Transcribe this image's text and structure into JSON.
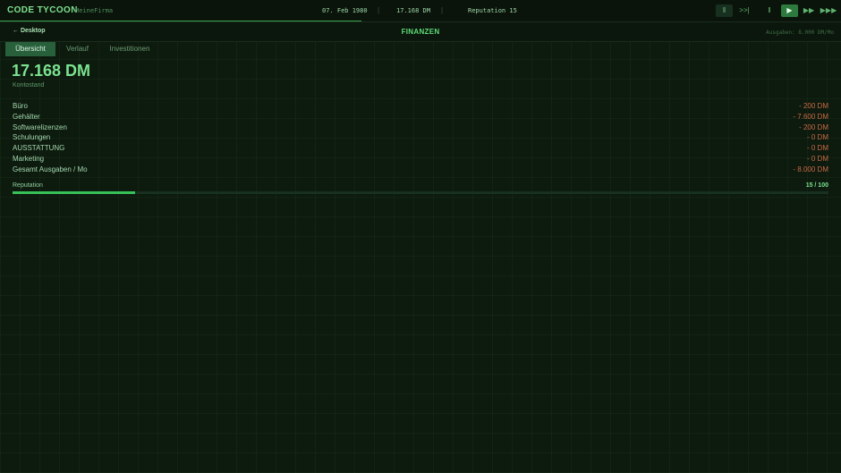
{
  "topbar": {
    "brand": "CODE TYCOON",
    "company": "MeineFirma",
    "date": "07. Feb 1980",
    "balance": "17.168 DM",
    "reputation": "Reputation 15",
    "controls": [
      "‖",
      ">>|",
      "‖",
      "▶",
      "▶▶",
      "▶▶▶"
    ]
  },
  "subheader": {
    "back": "← Desktop",
    "title": "FINANZEN",
    "spend": "Ausgaben: 8.000 DM/Mo"
  },
  "tabs": [
    "Übersicht",
    "Verlauf",
    "Investitionen"
  ],
  "overview": {
    "balance": "17.168 DM",
    "balance_label": "Kontostand",
    "expenses": [
      {
        "label": "Büro",
        "value": "- 200 DM"
      },
      {
        "label": "Gehälter",
        "value": "- 7.600 DM"
      },
      {
        "label": "Softwarelizenzen",
        "value": "- 200 DM"
      },
      {
        "label": "Schulungen",
        "value": "- 0 DM"
      },
      {
        "label": "AUSSTATTUNG",
        "value": "- 0 DM"
      },
      {
        "label": "Marketing",
        "value": "- 0 DM"
      },
      {
        "label": "Gesamt Ausgaben / Mo",
        "value": "- 8.000 DM"
      }
    ],
    "reputation_label": "Reputation",
    "reputation_value": "15 / 100",
    "reputation_level": 0.15
  },
  "colors": {
    "accent": "#5fdd78",
    "negative": "#c96a44",
    "background": "#0d1a0e"
  }
}
